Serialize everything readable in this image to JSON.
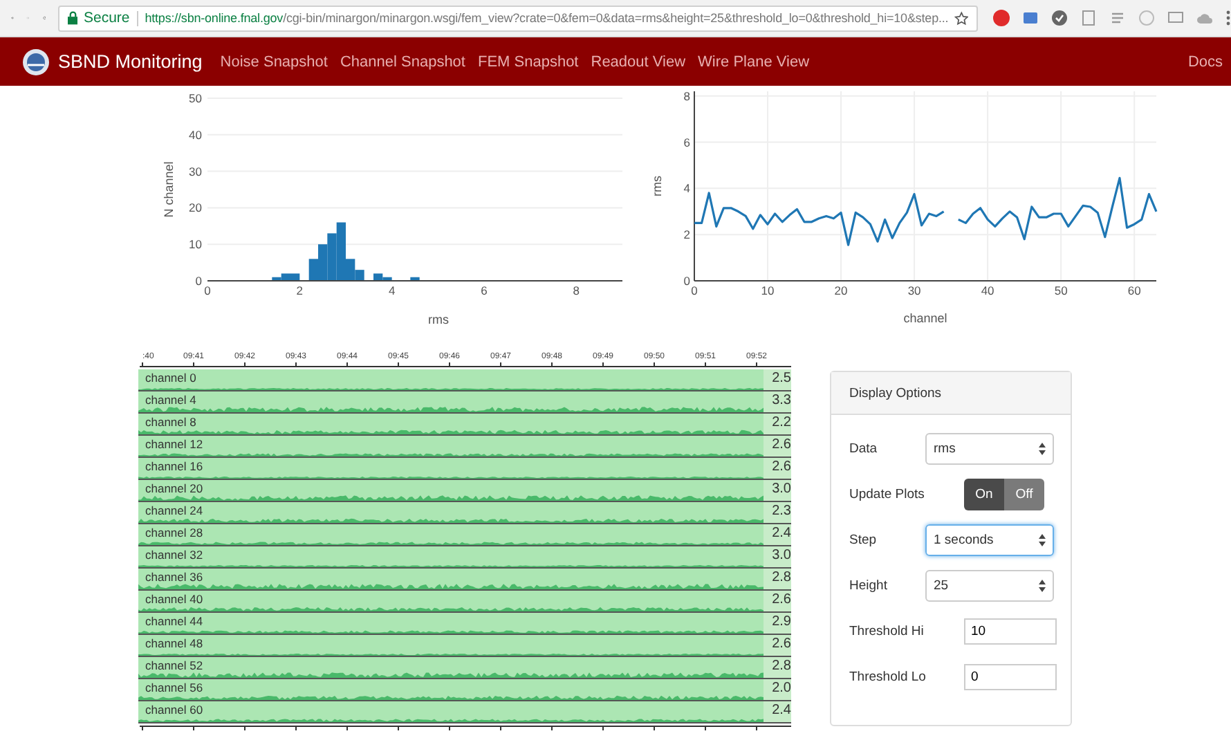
{
  "browser": {
    "secure_label": "Secure",
    "url_host": "https://sbn-online.fnal.gov",
    "url_path": "/cgi-bin/minargon/minargon.wsgi/fem_view?crate=0&fem=0&data=rms&height=25&threshold_lo=0&threshold_hi=10&step..."
  },
  "navbar": {
    "brand": "SBND Monitoring",
    "links": [
      "Noise Snapshot",
      "Channel Snapshot",
      "FEM Snapshot",
      "Readout View",
      "Wire Plane View"
    ],
    "right_link": "Docs"
  },
  "histogram": {
    "chart_data": {
      "type": "bar",
      "xlabel": "rms",
      "ylabel": "N channel",
      "x": [
        1.5,
        1.7,
        1.9,
        2.3,
        2.5,
        2.7,
        2.9,
        3.1,
        3.3,
        3.7,
        3.9,
        4.5
      ],
      "values": [
        1,
        2,
        2,
        6,
        10,
        13,
        16,
        6,
        3,
        2,
        1,
        1
      ],
      "grid": true,
      "xlim": [
        0,
        9
      ],
      "ylim": [
        0,
        50
      ],
      "xticks": [
        0,
        2,
        4,
        6,
        8
      ],
      "yticks": [
        0,
        10,
        20,
        30,
        40,
        50
      ]
    }
  },
  "rms_plot": {
    "chart_data": {
      "type": "line",
      "xlabel": "channel",
      "ylabel": "rms",
      "x": [
        0,
        1,
        2,
        3,
        4,
        5,
        6,
        7,
        8,
        9,
        10,
        11,
        12,
        13,
        14,
        15,
        16,
        17,
        18,
        19,
        20,
        21,
        22,
        23,
        24,
        25,
        26,
        27,
        28,
        29,
        30,
        31,
        32,
        33,
        34,
        36,
        37,
        38,
        39,
        40,
        41,
        42,
        43,
        44,
        45,
        46,
        47,
        48,
        49,
        50,
        51,
        52,
        53,
        54,
        55,
        56,
        57,
        58,
        59,
        60,
        61,
        62,
        63
      ],
      "values": [
        2.5,
        2.5,
        3.8,
        2.35,
        3.15,
        3.15,
        3.0,
        2.8,
        2.25,
        2.85,
        2.45,
        2.9,
        2.55,
        2.85,
        3.1,
        2.55,
        2.55,
        2.7,
        2.8,
        2.7,
        2.95,
        1.55,
        2.95,
        2.75,
        2.45,
        1.7,
        2.65,
        1.85,
        2.5,
        2.95,
        3.75,
        2.4,
        2.9,
        2.8,
        3.0,
        2.65,
        2.5,
        2.9,
        3.15,
        2.65,
        2.35,
        2.7,
        3.0,
        2.75,
        1.8,
        3.2,
        2.75,
        2.75,
        2.9,
        2.9,
        2.35,
        2.8,
        3.25,
        3.2,
        2.95,
        1.9,
        3.2,
        4.45,
        2.3,
        2.45,
        2.65,
        3.75,
        3.0
      ],
      "grid": true,
      "xlim": [
        0,
        63
      ],
      "ylim": [
        0,
        8.2
      ],
      "xticks": [
        0,
        10,
        20,
        30,
        40,
        50,
        60
      ],
      "yticks": [
        0,
        2,
        4,
        6,
        8
      ]
    }
  },
  "horizon": {
    "time_ticks": [
      ":40",
      "09:41",
      "09:42",
      "09:43",
      "09:44",
      "09:45",
      "09:46",
      "09:47",
      "09:48",
      "09:49",
      "09:50",
      "09:51",
      "09:52"
    ],
    "rows": [
      {
        "label": "channel 0",
        "value": "2.5"
      },
      {
        "label": "channel 4",
        "value": "3.3"
      },
      {
        "label": "channel 8",
        "value": "2.2"
      },
      {
        "label": "channel 12",
        "value": "2.6"
      },
      {
        "label": "channel 16",
        "value": "2.6"
      },
      {
        "label": "channel 20",
        "value": "3.0"
      },
      {
        "label": "channel 24",
        "value": "2.3"
      },
      {
        "label": "channel 28",
        "value": "2.4"
      },
      {
        "label": "channel 32",
        "value": "3.0"
      },
      {
        "label": "channel 36",
        "value": "2.8"
      },
      {
        "label": "channel 40",
        "value": "2.6"
      },
      {
        "label": "channel 44",
        "value": "2.9"
      },
      {
        "label": "channel 48",
        "value": "2.6"
      },
      {
        "label": "channel 52",
        "value": "2.8"
      },
      {
        "label": "channel 56",
        "value": "2.0"
      },
      {
        "label": "channel 60",
        "value": "2.4"
      }
    ]
  },
  "options": {
    "title": "Display Options",
    "fields": [
      {
        "kind": "select",
        "label": "Data",
        "value": "rms",
        "focused": false
      },
      {
        "kind": "toggle",
        "label": "Update Plots",
        "choices": [
          {
            "label": "On",
            "selected": true
          },
          {
            "label": "Off",
            "selected": false
          }
        ]
      },
      {
        "kind": "select",
        "label": "Step",
        "value": "1 seconds",
        "focused": true
      },
      {
        "kind": "select",
        "label": "Height",
        "value": "25",
        "focused": false
      },
      {
        "kind": "input",
        "label": "Threshold Hi",
        "value": "10"
      },
      {
        "kind": "input",
        "label": "Threshold Lo",
        "value": "0"
      }
    ]
  }
}
